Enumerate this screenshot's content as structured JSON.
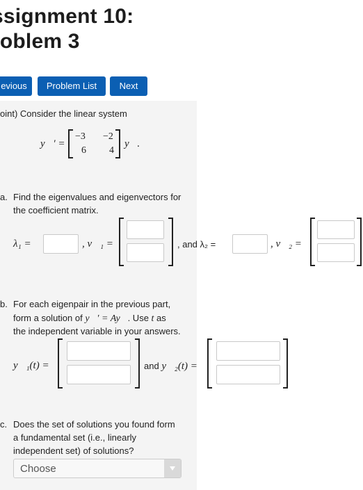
{
  "header": {
    "title_line1": "ssignment 10:",
    "title_line2": "roblem 3"
  },
  "nav": {
    "previous_label": "evious",
    "problem_list_label": "Problem List",
    "next_label": "Next"
  },
  "problem": {
    "intro": "oint) Consider the linear system",
    "system_lhs": "y⃗′ =",
    "matrix": {
      "a11": "−3",
      "a12": "−2",
      "a21": "6",
      "a22": "4"
    },
    "system_rhs": "y⃗.",
    "part_a": {
      "marker": "a.",
      "line1": "Find the eigenvalues and eigenvectors for",
      "line2": "the coefficient matrix.",
      "lambda1": "λ₁ =",
      "v1": ", v⃗₁ =",
      "and": ", and λ₂ =",
      "v2": ", v⃗₂ ="
    },
    "part_b": {
      "marker": "b.",
      "line1": "For each eigenpair in the previous part,",
      "line2_pre": "form a solution of ",
      "line2_eq": "y⃗′ = Ay⃗",
      "line2_post": ". Use ",
      "line2_t": "t",
      "line2_end": " as",
      "line3": "the independent variable in your answers.",
      "y1": "y⃗₁(t) =",
      "and": "and ",
      "y2": "y⃗₂(t) ="
    },
    "part_c": {
      "marker": "c.",
      "line1": "Does the set of solutions you found form",
      "line2": "a fundamental set (i.e., linearly",
      "line3": "independent set) of solutions?",
      "select_value": "Choose"
    }
  }
}
